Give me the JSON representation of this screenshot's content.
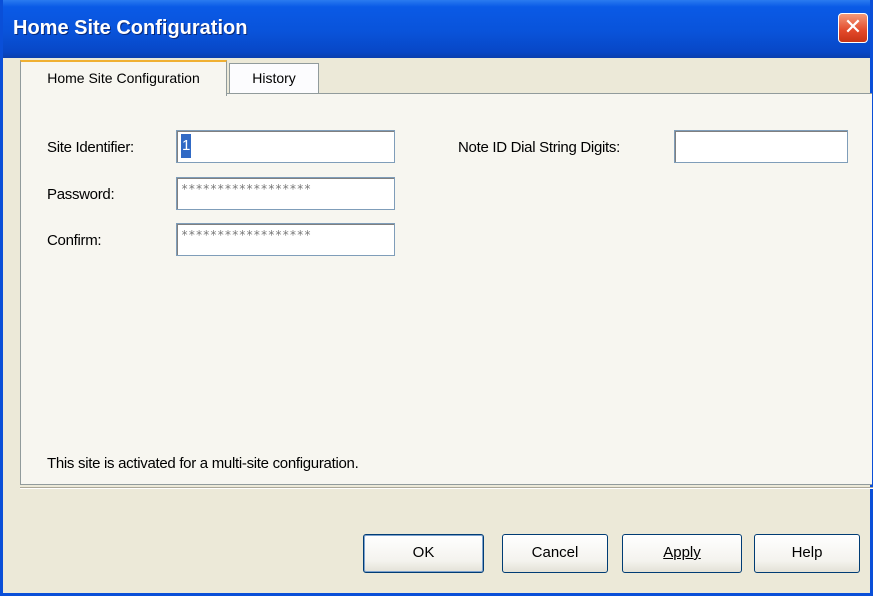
{
  "window": {
    "title": "Home Site Configuration",
    "close_glyph": "✕"
  },
  "tabs": [
    {
      "label": "Home Site Configuration",
      "active": true
    },
    {
      "label": "History",
      "active": false
    }
  ],
  "form": {
    "site_identifier": {
      "label": "Site Identifier:",
      "value": "1"
    },
    "password": {
      "label": "Password:",
      "value": "******************"
    },
    "confirm": {
      "label": "Confirm:",
      "value": "******************"
    },
    "note_id_dial_string_digits": {
      "label": "Note ID Dial String Digits:",
      "value": ""
    }
  },
  "status_text": "This site is activated for a multi-site configuration.",
  "buttons": {
    "ok": "OK",
    "cancel": "Cancel",
    "apply": "Apply",
    "help": "Help"
  },
  "colors": {
    "titlebar": "#0953da",
    "dialog_bg": "#ece9d8",
    "close_button": "#e2492a",
    "selection": "#316ac5"
  }
}
